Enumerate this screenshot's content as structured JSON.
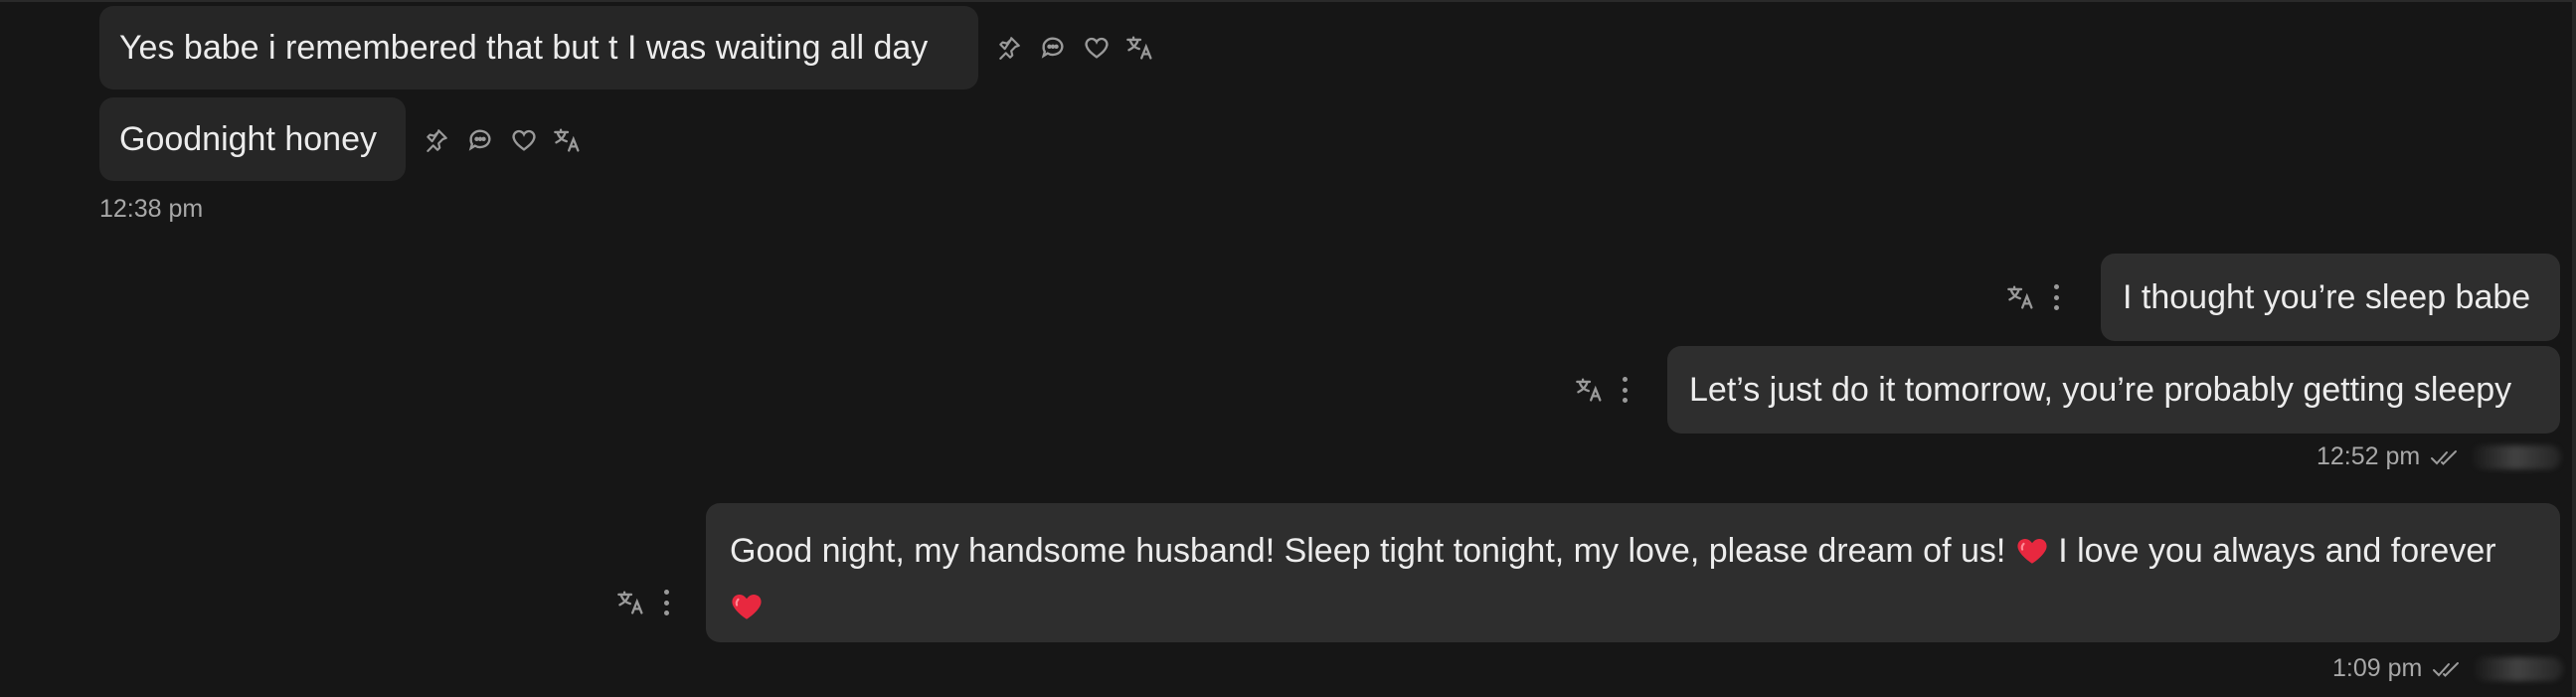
{
  "messages": [
    {
      "id": "m1",
      "direction": "incoming",
      "text": "Yes babe i remembered that but t I was waiting all day"
    },
    {
      "id": "m2",
      "direction": "incoming",
      "text": "Goodnight honey"
    },
    {
      "id": "m3",
      "direction": "outgoing",
      "text": "I thought you’re sleep babe"
    },
    {
      "id": "m4",
      "direction": "outgoing",
      "text": "Let’s just do it tomorrow, you’re probably getting sleepy"
    },
    {
      "id": "m5",
      "direction": "outgoing",
      "text_part1": "Good night, my handsome husband! Sleep tight tonight, my love, please dream of us!",
      "text_part2": " I love you always and forever"
    }
  ],
  "timestamps": {
    "incoming_group": "12:38 pm",
    "outgoing_group_1": "12:52 pm",
    "outgoing_group_2": "1:09 pm"
  },
  "icons": {
    "incoming_actions": [
      "pin-icon",
      "reply-icon",
      "heart-icon",
      "translate-icon"
    ],
    "outgoing_actions": [
      "translate-icon",
      "more-options-icon"
    ],
    "read_receipt": "double-check-icon",
    "emoji": "red-heart-emoji"
  },
  "colors": {
    "background": "#161616",
    "bubble_incoming": "#262626",
    "bubble_outgoing": "#2e2e2e",
    "text": "#ececec",
    "muted": "#9a9a9a",
    "heart": "#e8283f"
  }
}
